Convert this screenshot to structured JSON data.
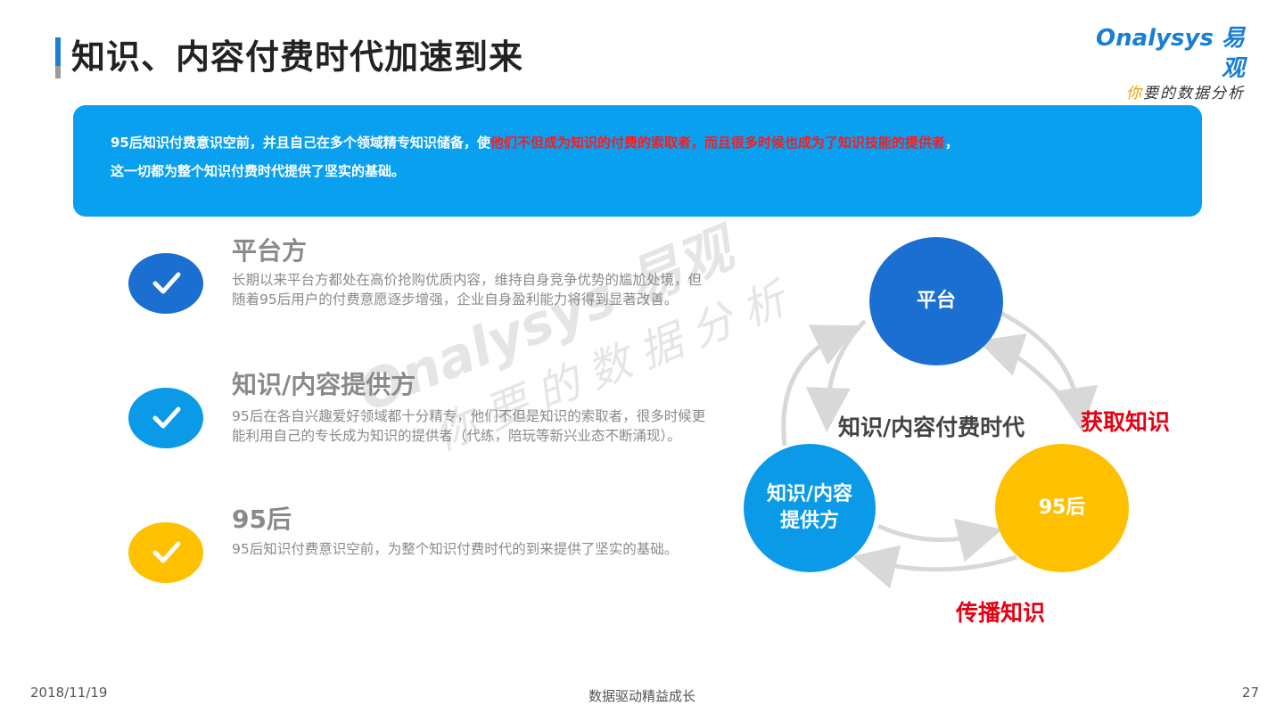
{
  "header": {
    "title": "知识、内容付费时代加速到来",
    "logo_main": "Onalysys 易观",
    "logo_tagline_first": "你",
    "logo_tagline_rest": "要的数据分析"
  },
  "banner": {
    "line1_prefix": "95后知识付费意识空前，并且自己在多个领域精专知识储备，使",
    "line1_highlight": "他们不但成为知识的付费的索取者，而且很多时候也成为了知识技能的提供者",
    "line1_suffix": "，",
    "line2": "这一切都为整个知识付费时代提供了坚实的基础。"
  },
  "items": [
    {
      "title": "平台方",
      "desc": "长期以来平台方都处在高价抢购优质内容，维持自身竞争优势的尴尬处境，但随着95后用户的付费意愿逐步增强，企业自身盈利能力将得到显著改善。"
    },
    {
      "title": "知识/内容提供方",
      "desc": "95后在各自兴趣爱好领域都十分精专，他们不但是知识的索取者，很多时候更能利用自己的专长成为知识的提供者（代练，陪玩等新兴业态不断涌现）。"
    },
    {
      "title": "95后",
      "desc": "95后知识付费意识空前，为整个知识付费时代的到来提供了坚实的基础。"
    }
  ],
  "watermark": {
    "line1": "Onalysys 易观",
    "line2": "你要的数据分析"
  },
  "cycle": {
    "node_platform": "平台",
    "node_provider_line1": "知识/内容",
    "node_provider_line2": "提供方",
    "node_95": "95后",
    "center": "知识/内容付费时代",
    "label_acquire": "获取知识",
    "label_spread": "传播知识"
  },
  "footer": {
    "date": "2018/11/19",
    "slogan": "数据驱动精益成长",
    "page": "27"
  },
  "colors": {
    "banner_bg": "#0aa0f0",
    "highlight_red": "#ff1a1a",
    "blue_dark": "#1a6fd0",
    "blue": "#0a9ae8",
    "yellow": "#ffc000",
    "label_red": "#e60012"
  }
}
